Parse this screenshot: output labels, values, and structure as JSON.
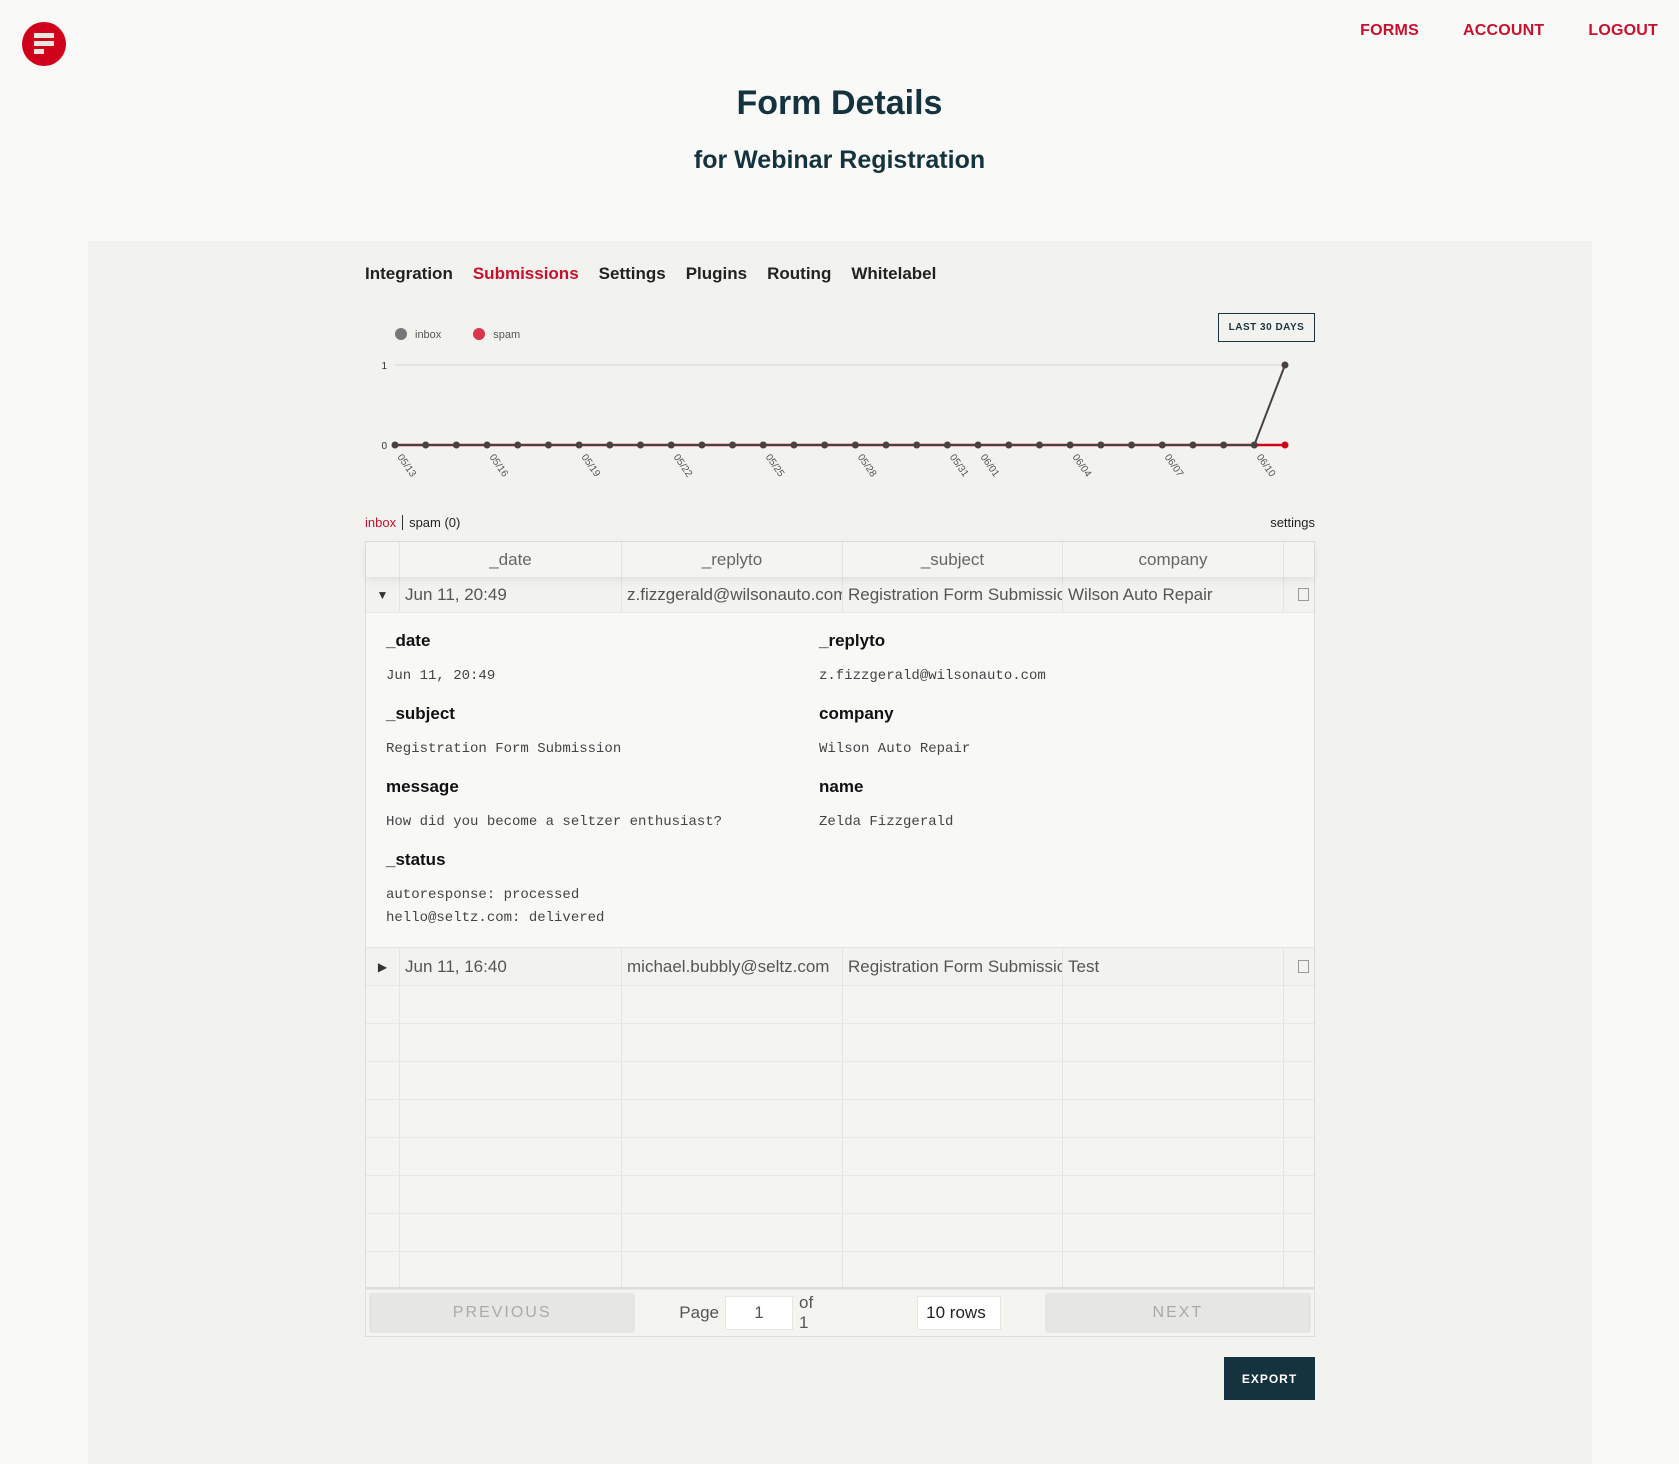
{
  "nav": {
    "forms": "FORMS",
    "account": "ACCOUNT",
    "logout": "LOGOUT"
  },
  "header": {
    "title": "Form Details",
    "subtitle": "for Webinar Registration"
  },
  "tabs": [
    "Integration",
    "Submissions",
    "Settings",
    "Plugins",
    "Routing",
    "Whitelabel"
  ],
  "active_tab": "Submissions",
  "range_button": "LAST 30 DAYS",
  "chart_data": {
    "type": "line",
    "legend_position": "top-left",
    "series": [
      {
        "name": "inbox",
        "color": "#4a4040",
        "legend_color": "#777777"
      },
      {
        "name": "spam",
        "color": "#d0021b",
        "legend_color": "#d9374b"
      }
    ],
    "x": [
      "05/13",
      "05/14",
      "05/15",
      "05/16",
      "05/17",
      "05/18",
      "05/19",
      "05/20",
      "05/21",
      "05/22",
      "05/23",
      "05/24",
      "05/25",
      "05/26",
      "05/27",
      "05/28",
      "05/29",
      "05/30",
      "05/31",
      "06/01",
      "06/02",
      "06/03",
      "06/04",
      "06/05",
      "06/06",
      "06/07",
      "06/08",
      "06/09",
      "06/10",
      "06/11"
    ],
    "inbox": [
      0,
      0,
      0,
      0,
      0,
      0,
      0,
      0,
      0,
      0,
      0,
      0,
      0,
      0,
      0,
      0,
      0,
      0,
      0,
      0,
      0,
      0,
      0,
      0,
      0,
      0,
      0,
      0,
      0,
      1
    ],
    "spam": [
      0,
      0,
      0,
      0,
      0,
      0,
      0,
      0,
      0,
      0,
      0,
      0,
      0,
      0,
      0,
      0,
      0,
      0,
      0,
      0,
      0,
      0,
      0,
      0,
      0,
      0,
      0,
      0,
      0,
      0
    ],
    "x_tick_labels": [
      "05/13",
      "05/16",
      "05/19",
      "05/22",
      "05/25",
      "05/28",
      "05/31",
      "06/01",
      "06/04",
      "06/07",
      "06/10"
    ],
    "y_ticks": [
      "0",
      "1"
    ],
    "ylim": [
      0,
      1
    ],
    "grid": true
  },
  "subtabs": {
    "inbox": "inbox",
    "spam": "spam (0)",
    "settings": "settings"
  },
  "table": {
    "columns": [
      "_date",
      "_replyto",
      "_subject",
      "company"
    ],
    "rows": [
      {
        "date": "Jun 11, 20:49",
        "replyto": "z.fizzgerald@wilsonauto.com",
        "subject": "Registration Form Submission",
        "company": "Wilson Auto Repair",
        "expanded": true
      },
      {
        "date": "Jun 11, 16:40",
        "replyto": "michael.bubbly@seltz.com",
        "subject": "Registration Form Submission",
        "company": "Test",
        "expanded": false
      }
    ]
  },
  "detail": {
    "date_label": "_date",
    "date": "Jun 11, 20:49",
    "replyto_label": "_replyto",
    "replyto": "z.fizzgerald@wilsonauto.com",
    "subject_label": "_subject",
    "subject": "Registration Form Submission",
    "company_label": "company",
    "company": "Wilson Auto Repair",
    "message_label": "message",
    "message": "How did you become a seltzer enthusiast?",
    "name_label": "name",
    "name": "Zelda Fizzgerald",
    "status_label": "_status",
    "status_1": "autoresponse: processed",
    "status_2": "hello@seltz.com: delivered"
  },
  "pager": {
    "previous": "PREVIOUS",
    "page_label": "Page",
    "page": "1",
    "of": "of 1",
    "rows": "10 rows",
    "next": "NEXT"
  },
  "export": "EXPORT"
}
